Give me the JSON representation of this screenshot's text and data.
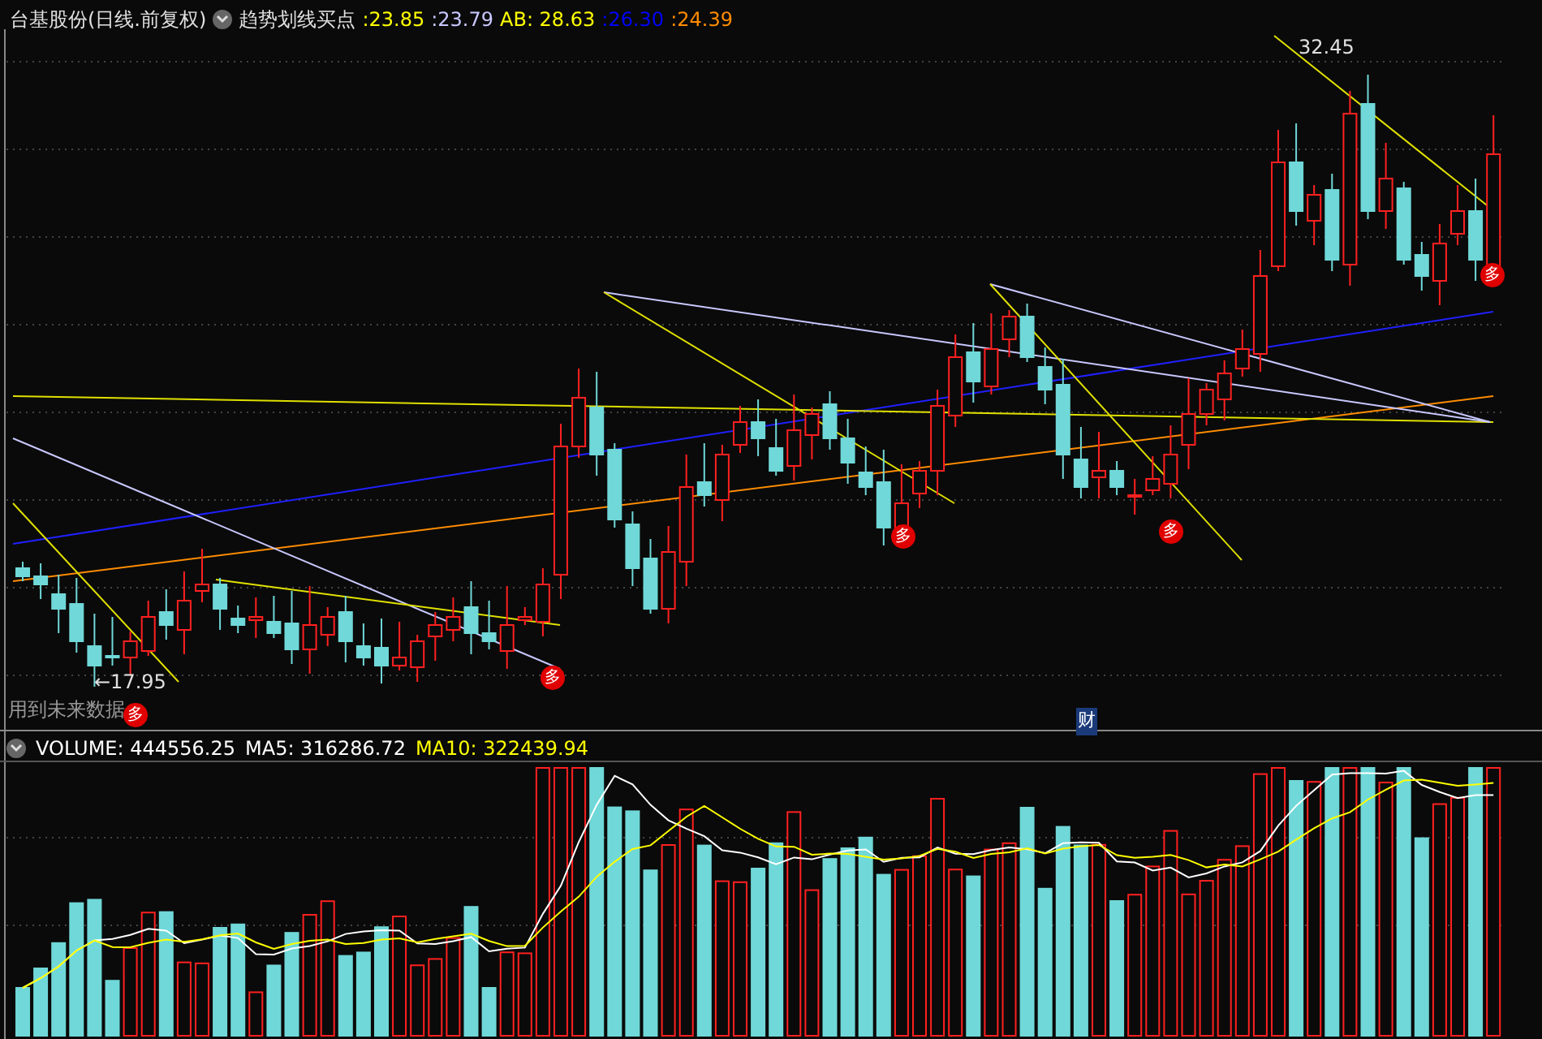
{
  "header": {
    "title": "台基股份(日线.前复权)",
    "indicator": "趋势划线买点",
    "values": [
      {
        "text": ":23.85",
        "color": "#ffff00"
      },
      {
        "text": ":23.79",
        "color": "#c8c8ff"
      },
      {
        "text": "AB: 28.63",
        "color": "#ffff00"
      },
      {
        "text": ":26.30",
        "color": "#0000ff"
      },
      {
        "text": ":24.39",
        "color": "#ff8c00"
      }
    ]
  },
  "price_labels": {
    "high": "32.45",
    "low": "←17.95"
  },
  "buy_markers": [
    "多",
    "多",
    "多",
    "多",
    "多"
  ],
  "note": "用到未来数据",
  "finance_tag": "财",
  "volume_header": [
    {
      "text": "VOLUME: 444556.25",
      "color": "#ffffff"
    },
    {
      "text": "MA5: 316286.72",
      "color": "#ffffff"
    },
    {
      "text": "MA10: 322439.94",
      "color": "#ffff00"
    }
  ]
}
